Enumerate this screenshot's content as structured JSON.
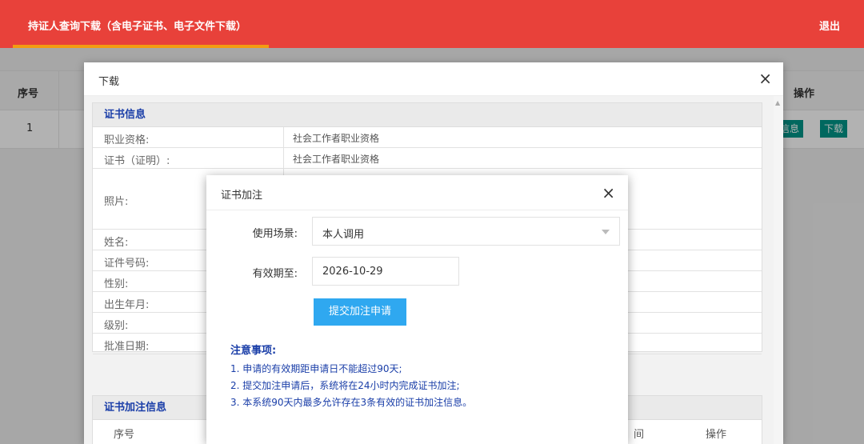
{
  "header": {
    "title": "持证人查询下载（含电子证书、电子文件下载）",
    "logout": "退出"
  },
  "background_table": {
    "col_seq": "序号",
    "col_op": "操作",
    "row_seq": "1",
    "btn_info": "信息",
    "btn_download": "下载"
  },
  "download_modal": {
    "title": "下载",
    "close": "×",
    "cert_section": {
      "title": "证书信息",
      "rows": [
        {
          "label": "职业资格:",
          "value": "社会工作者职业资格"
        },
        {
          "label": "证书（证明）:",
          "value": "社会工作者职业资格"
        },
        {
          "label": "照片:",
          "value": ""
        },
        {
          "label": "姓名:",
          "value": ""
        },
        {
          "label": "证件号码:",
          "value": ""
        },
        {
          "label": "性别:",
          "value": ""
        },
        {
          "label": "出生年月:",
          "value": ""
        },
        {
          "label": "级别:",
          "value": ""
        },
        {
          "label": "批准日期:",
          "value": ""
        }
      ]
    },
    "annotation_section": {
      "title": "证书加注信息",
      "col_seq": "序号",
      "col_time": "间",
      "col_op": "操作"
    }
  },
  "annotation_modal": {
    "title": "证书加注",
    "close": "×",
    "scene_label": "使用场景:",
    "scene_value": "本人调用",
    "expiry_label": "有效期至:",
    "expiry_value": "2026-10-29",
    "submit_label": "提交加注申请",
    "notice_title": "注意事项:",
    "notice_items": [
      "1. 申请的有效期距申请日不能超过90天;",
      "2. 提交加注申请后，系统将在24小时内完成证书加注;",
      "3. 本系统90天内最多允许存在3条有效的证书加注信息。"
    ]
  },
  "colors": {
    "header_bg": "#e8413a",
    "tab_underline": "#f39c12",
    "primary_button": "#2fa8f0",
    "teal_button": "#009688",
    "notice_text": "#1a3ea8"
  }
}
